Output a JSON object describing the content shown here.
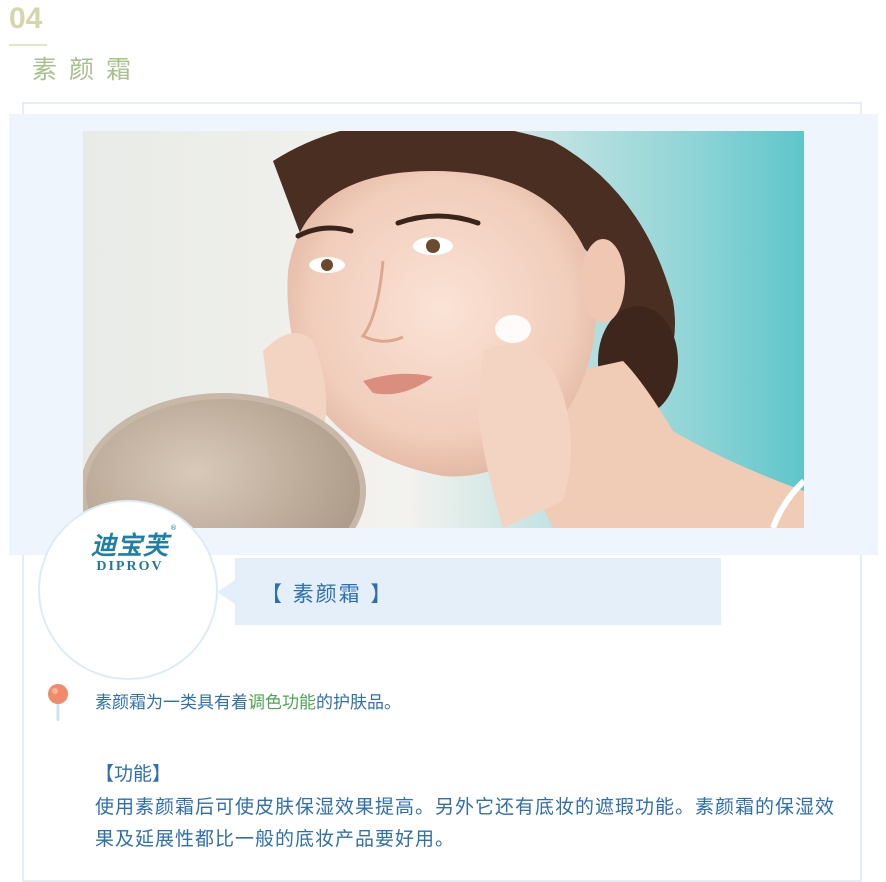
{
  "section": {
    "number": "04",
    "title": "素颜霜"
  },
  "brand": {
    "name_cn": "迪宝芙",
    "name_en": "DIPROV",
    "reg_mark": "®"
  },
  "label": {
    "text": "【 素颜霜 】"
  },
  "intro": {
    "before": "素颜霜为一类具有着",
    "highlight": "调色功能",
    "after": "的护肤品。"
  },
  "function": {
    "heading": "【功能】",
    "body": "使用素颜霜后可使皮肤保湿效果提高。另外它还有底妆的遮瑕功能。素颜霜的保湿效果及延展性都比一般的底妆产品要好用。"
  },
  "colors": {
    "accent_blue": "#2f6fb0",
    "highlight_green": "#4ca653",
    "number_color": "#d6d6ad",
    "title_green": "#a9c08e",
    "band_blue": "#eef5fd"
  }
}
